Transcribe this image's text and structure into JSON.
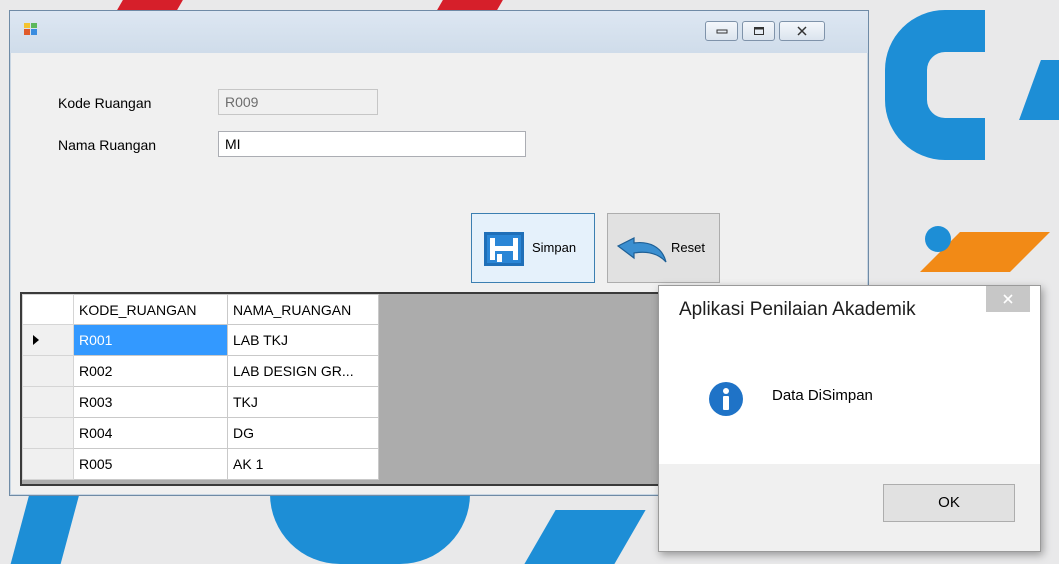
{
  "form": {
    "kode_label": "Kode Ruangan",
    "kode_value": "R009",
    "nama_label": "Nama Ruangan",
    "nama_value": "MI",
    "simpan_label": "Simpan",
    "reset_label": "Reset"
  },
  "grid": {
    "columns": [
      "KODE_RUANGAN",
      "NAMA_RUANGAN"
    ],
    "rows": [
      {
        "kode": "R001",
        "nama": "LAB TKJ"
      },
      {
        "kode": "R002",
        "nama": "LAB DESIGN GR..."
      },
      {
        "kode": "R003",
        "nama": "TKJ"
      },
      {
        "kode": "R004",
        "nama": "DG"
      },
      {
        "kode": "R005",
        "nama": "AK 1"
      }
    ]
  },
  "dialog": {
    "title": "Aplikasi Penilaian Akademik",
    "message": "Data DiSimpan",
    "ok_label": "OK"
  },
  "colors": {
    "accent_blue": "#1d8ed6",
    "accent_orange": "#f28a16",
    "selection": "#3399ff"
  }
}
